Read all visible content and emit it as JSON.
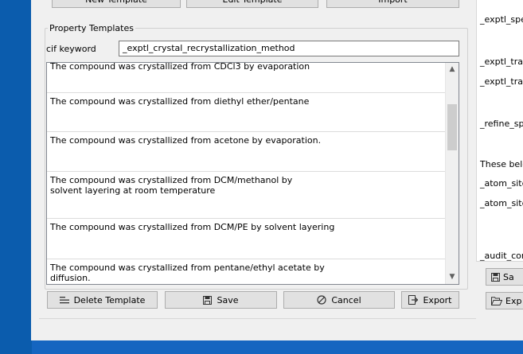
{
  "top_buttons": {
    "new_template": "New Template",
    "edit_template": "Edit Template",
    "import": "Import"
  },
  "group_title": "Property Templates",
  "keyword": {
    "label": "cif keyword",
    "value": "_exptl_crystal_recrystallization_method"
  },
  "templates": [
    "The compound was crystallized from CDCl3 by evaporation",
    "The compound was crystallized from diethyl ether/pentane",
    "The compound was crystallized from acetone by evaporation.",
    "The compound was crystallized from DCM/methanol by\nsolvent layering at room temperature",
    "The compound was crystallized from DCM/PE by solvent layering",
    "The compound was crystallized from pentane/ethyl acetate by\ndiffusion."
  ],
  "buttons": {
    "delete": "Delete Template",
    "save": "Save",
    "cancel": "Cancel",
    "export": "Export"
  },
  "side_items": [
    "_exptl_spe",
    "_exptl_tran",
    "_exptl_tran",
    "_refine_spe",
    "These belo",
    "_atom_site",
    "_atom_site",
    "_audit_con"
  ],
  "side_buttons": [
    "Sa",
    "Exp"
  ]
}
